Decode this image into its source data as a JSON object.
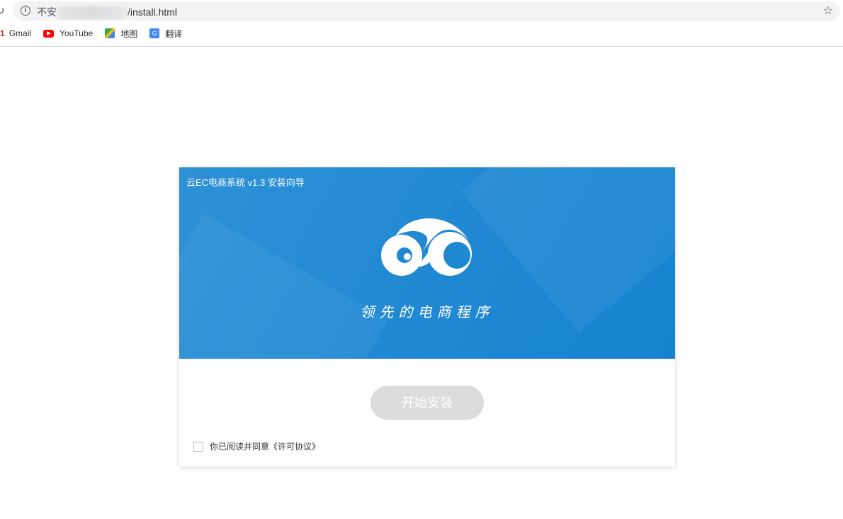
{
  "browser": {
    "url_prefix": "不安",
    "url_path": "/install.html",
    "bookmarks": [
      {
        "label": "Gmail",
        "icon": "gmail-icon"
      },
      {
        "label": "YouTube",
        "icon": "youtube-icon"
      },
      {
        "label": "地图",
        "icon": "maps-icon"
      },
      {
        "label": "翻译",
        "icon": "translate-icon"
      }
    ]
  },
  "installer": {
    "title": "云EC电商系统 v1.3 安装向导",
    "slogan": "领先的电商程序",
    "start_button": "开始安装",
    "agree_label": "你已阅读并同意《许可协议》",
    "agree_checked": false,
    "accent": "#1f88d3",
    "button_disabled_color": "#dcdcdc"
  }
}
